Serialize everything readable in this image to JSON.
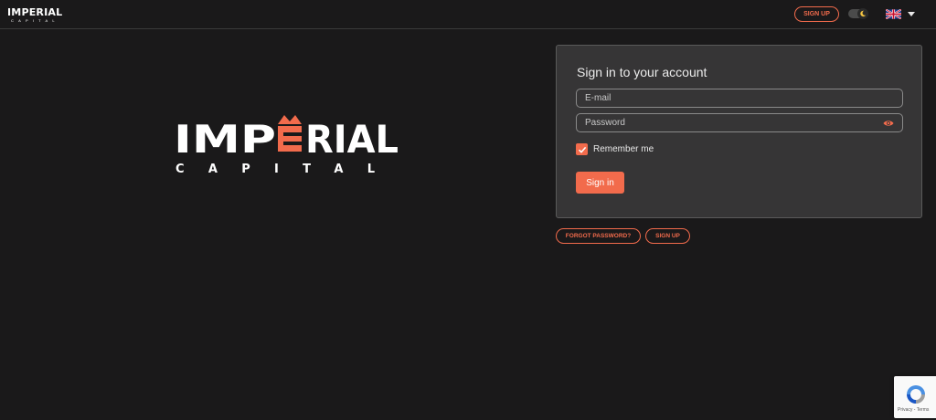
{
  "brand": {
    "name": "IMPERIAL",
    "tagline": "CAPITAL",
    "accent_color": "#f26b4c"
  },
  "header": {
    "signup_label": "SIGN UP",
    "theme_icon": "moon-icon",
    "language_flag": "uk-flag-icon",
    "language_caret": "chevron-down-icon"
  },
  "login": {
    "title": "Sign in to your account",
    "email_placeholder": "E-mail",
    "password_placeholder": "Password",
    "password_toggle_icon": "eye-icon",
    "remember_label": "Remember me",
    "remember_checked": true,
    "submit_label": "Sign in"
  },
  "links": {
    "forgot_label": "FORGOT PASSWORD?",
    "signup_label": "SIGN UP"
  },
  "recaptcha": {
    "text": "Privacy - Terms"
  }
}
